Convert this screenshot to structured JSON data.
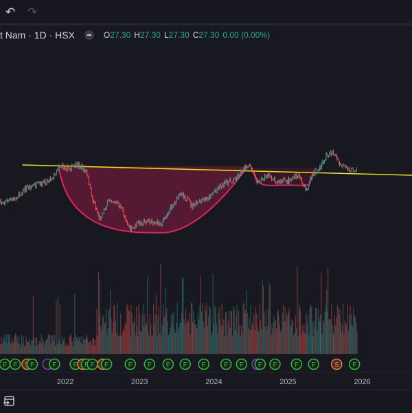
{
  "toolbar": {
    "undo_icon": "undo-icon",
    "redo_icon": "redo-icon"
  },
  "legend": {
    "symbol": "t Nam · 1D · HSX",
    "o_label": "O",
    "o": "27.30",
    "h_label": "H",
    "h": "27.30",
    "l_label": "L",
    "l": "27.30",
    "c_label": "C",
    "c": "27.30",
    "change": "0.00 (0.00%)"
  },
  "bottom": {
    "icon": "calendar-goto-icon"
  },
  "colors": {
    "bg": "#181821",
    "trendline": "#f2e600",
    "cup_fill": "#6b1a3a",
    "cup_stroke": "#e0245e",
    "up": "#26a69a",
    "down": "#ef5350",
    "event_f": "#2fbf3a",
    "event_s": "#e8833a"
  },
  "chart_data": {
    "type": "line",
    "title": "t Nam · 1D · HSX",
    "x_ticks": [
      "2022",
      "2023",
      "2024",
      "2025",
      "2026"
    ],
    "x_tick_values": [
      2022,
      2023,
      2024,
      2025,
      2026
    ],
    "xlim": [
      2021.12,
      2026.67
    ],
    "ylim": [
      11.5,
      43.5
    ],
    "series": [
      {
        "name": "price",
        "x": [
          2021.12,
          2021.31,
          2021.49,
          2021.68,
          2021.86,
          2021.91,
          2022.05,
          2022.18,
          2022.28,
          2022.37,
          2022.46,
          2022.6,
          2022.74,
          2022.88,
          2022.97,
          2023.11,
          2023.3,
          2023.43,
          2023.57,
          2023.71,
          2023.9,
          2024.08,
          2024.27,
          2024.41,
          2024.5,
          2024.59,
          2024.73,
          2024.87,
          2025.01,
          2025.15,
          2025.24,
          2025.33,
          2025.43,
          2025.52,
          2025.61,
          2025.7,
          2025.84,
          2025.93
        ],
        "y": [
          21.8,
          22.35,
          24.33,
          24.77,
          26.2,
          27.85,
          27.3,
          27.85,
          26.75,
          22.35,
          19.27,
          22.35,
          21.25,
          17.4,
          18.5,
          18.83,
          18.5,
          21.25,
          23.45,
          21.25,
          22.35,
          24.55,
          25.43,
          27.3,
          27.52,
          25.1,
          26.2,
          25.1,
          25.43,
          26.2,
          23.67,
          26.2,
          27.3,
          29.5,
          29.83,
          27.85,
          26.97,
          27.3
        ]
      }
    ],
    "annotations": {
      "trendline": {
        "x": [
          2021.42,
          2026.67
        ],
        "y": [
          27.85,
          26.2
        ]
      },
      "cup": {
        "x": [
          2021.91,
          2024.45
        ],
        "bottom": [
          2023.3,
          17.0
        ],
        "rim": 27.6
      },
      "handle": {
        "x": [
          2024.5,
          2025.38
        ],
        "bottom": [
          2024.98,
          24.6
        ],
        "rim": 27.4
      }
    },
    "events": [
      {
        "t": 2021.12,
        "type": "F"
      },
      {
        "t": 2021.26,
        "type": "F"
      },
      {
        "t": 2021.42,
        "type": "S"
      },
      {
        "t": 2021.49,
        "type": "F"
      },
      {
        "t": 2021.7,
        "type": "D"
      },
      {
        "t": 2021.79,
        "type": "F"
      },
      {
        "t": 2022.07,
        "type": "F"
      },
      {
        "t": 2022.17,
        "type": "S"
      },
      {
        "t": 2022.22,
        "type": "F"
      },
      {
        "t": 2022.3,
        "type": "F"
      },
      {
        "t": 2022.44,
        "type": "S"
      },
      {
        "t": 2022.49,
        "type": "F"
      },
      {
        "t": 2022.81,
        "type": "F"
      },
      {
        "t": 2023.07,
        "type": "F"
      },
      {
        "t": 2023.32,
        "type": "F"
      },
      {
        "t": 2023.55,
        "type": "F"
      },
      {
        "t": 2023.8,
        "type": "F"
      },
      {
        "t": 2024.1,
        "type": "F"
      },
      {
        "t": 2024.31,
        "type": "F"
      },
      {
        "t": 2024.52,
        "type": "D"
      },
      {
        "t": 2024.56,
        "type": "F"
      },
      {
        "t": 2024.76,
        "type": "F"
      },
      {
        "t": 2025.05,
        "type": "F"
      },
      {
        "t": 2025.28,
        "type": "F"
      },
      {
        "t": 2025.59,
        "type": "S"
      },
      {
        "t": 2025.83,
        "type": "F"
      }
    ]
  }
}
